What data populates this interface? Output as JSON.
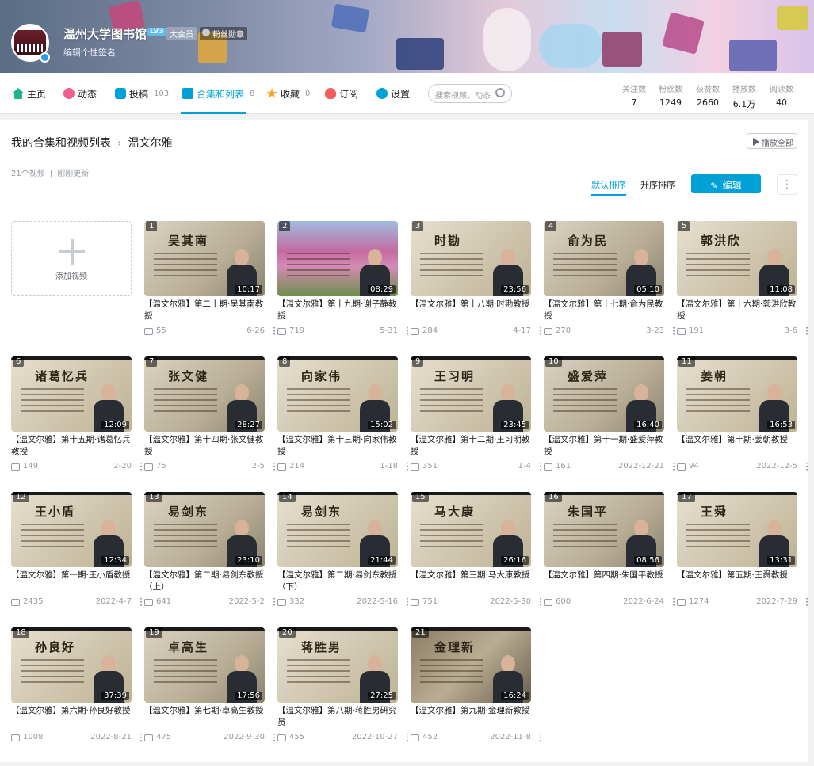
{
  "header": {
    "user_name": "温州大学图书馆",
    "level": "LV3",
    "vip": "大会员",
    "fan_badge": "粉丝勋章",
    "signature": "编辑个性签名"
  },
  "nav": {
    "items": [
      {
        "label": "主页",
        "count": ""
      },
      {
        "label": "动态",
        "count": ""
      },
      {
        "label": "投稿",
        "count": "103"
      },
      {
        "label": "合集和列表",
        "count": "8"
      },
      {
        "label": "收藏",
        "count": "0"
      },
      {
        "label": "订阅",
        "count": ""
      },
      {
        "label": "设置",
        "count": ""
      }
    ],
    "search_placeholder": "搜索视频、动态"
  },
  "stats": [
    {
      "label": "关注数",
      "value": "7"
    },
    {
      "label": "粉丝数",
      "value": "1249"
    },
    {
      "label": "获赞数",
      "value": "2660"
    },
    {
      "label": "播放数",
      "value": "6.1万"
    },
    {
      "label": "阅读数",
      "value": "40"
    }
  ],
  "breadcrumb": {
    "root": "我的合集和视频列表",
    "current": "温文尔雅"
  },
  "meta": {
    "count": "21个视频",
    "updated": "刚刚更新"
  },
  "toolbar": {
    "play_all": "播放全部",
    "sort_default": "默认排序",
    "sort_asc": "升序排序",
    "edit": "编辑"
  },
  "add_video": "添加视频",
  "videos": [
    {
      "idx": "1",
      "duration": "10:17",
      "title": "【温文尔雅】第二十期·吴其南教授",
      "views": "55",
      "date": "6-26",
      "name": "吴其南"
    },
    {
      "idx": "2",
      "duration": "08:29",
      "title": "【温文尔雅】第十九期·谢子静教授",
      "views": "719",
      "date": "5-31",
      "name": ""
    },
    {
      "idx": "3",
      "duration": "23:56",
      "title": "【温文尔雅】第十八期·时勘教授",
      "views": "284",
      "date": "4-17",
      "name": "时勘"
    },
    {
      "idx": "4",
      "duration": "05:10",
      "title": "【温文尔雅】第十七期·俞为民教授",
      "views": "270",
      "date": "3-23",
      "name": "俞为民"
    },
    {
      "idx": "5",
      "duration": "11:08",
      "title": "【温文尔雅】第十六期·郭洪欣教授",
      "views": "191",
      "date": "3-6",
      "name": "郭洪欣"
    },
    {
      "idx": "6",
      "duration": "12:09",
      "title": "【温文尔雅】第十五期·诸葛忆兵教授",
      "views": "149",
      "date": "2-20",
      "name": "诸葛忆兵"
    },
    {
      "idx": "7",
      "duration": "28:27",
      "title": "【温文尔雅】第十四期·张文健教授",
      "views": "75",
      "date": "2-5",
      "name": "张文健"
    },
    {
      "idx": "8",
      "duration": "15:02",
      "title": "【温文尔雅】第十三期·向家伟教授",
      "views": "214",
      "date": "1-18",
      "name": "向家伟"
    },
    {
      "idx": "9",
      "duration": "23:45",
      "title": "【温文尔雅】第十二期·王习明教授",
      "views": "351",
      "date": "1-4",
      "name": "王习明"
    },
    {
      "idx": "10",
      "duration": "16:40",
      "title": "【温文尔雅】第十一期·盛爱萍教授",
      "views": "161",
      "date": "2022-12-21",
      "name": "盛爱萍"
    },
    {
      "idx": "11",
      "duration": "16:53",
      "title": "【温文尔雅】第十期·姜朝教授",
      "views": "94",
      "date": "2022-12-5",
      "name": "姜朝"
    },
    {
      "idx": "12",
      "duration": "12:34",
      "title": "【温文尔雅】第一期·王小盾教授",
      "views": "2435",
      "date": "2022-4-7",
      "name": "王小盾"
    },
    {
      "idx": "13",
      "duration": "23:10",
      "title": "【温文尔雅】第二期·易剑东教授（上）",
      "views": "641",
      "date": "2022-5-2",
      "name": "易剑东"
    },
    {
      "idx": "14",
      "duration": "21:44",
      "title": "【温文尔雅】第二期·易剑东教授（下）",
      "views": "332",
      "date": "2022-5-16",
      "name": "易剑东"
    },
    {
      "idx": "15",
      "duration": "26:16",
      "title": "【温文尔雅】第三期·马大康教授",
      "views": "751",
      "date": "2022-5-30",
      "name": "马大康"
    },
    {
      "idx": "16",
      "duration": "08:56",
      "title": "【温文尔雅】第四期·朱国平教授",
      "views": "600",
      "date": "2022-6-24",
      "name": "朱国平"
    },
    {
      "idx": "17",
      "duration": "13:31",
      "title": "【温文尔雅】第五期·王舜教授",
      "views": "1274",
      "date": "2022-7-29",
      "name": "王舜"
    },
    {
      "idx": "18",
      "duration": "37:39",
      "title": "【温文尔雅】第六期·孙良好教授",
      "views": "1008",
      "date": "2022-8-21",
      "name": "孙良好"
    },
    {
      "idx": "19",
      "duration": "17:56",
      "title": "【温文尔雅】第七期·卓高生教授",
      "views": "475",
      "date": "2022-9-30",
      "name": "卓高生"
    },
    {
      "idx": "20",
      "duration": "27:25",
      "title": "【温文尔雅】第八期·蒋胜男研究员",
      "views": "455",
      "date": "2022-10-27",
      "name": "蒋胜男"
    },
    {
      "idx": "21",
      "duration": "16:24",
      "title": "【温文尔雅】第九期·金理新教授",
      "views": "452",
      "date": "2022-11-8",
      "name": "金理新"
    }
  ],
  "colors": {
    "accent": "#00a1d6",
    "text": "#18191c",
    "muted": "#9499a0"
  }
}
